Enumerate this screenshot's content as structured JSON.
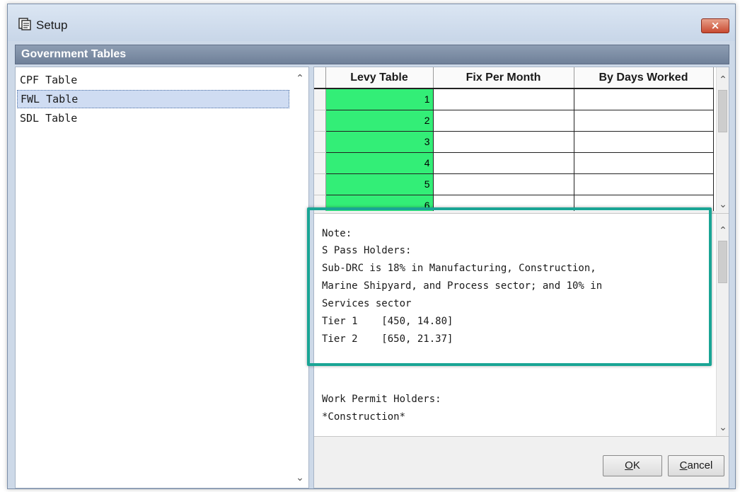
{
  "window": {
    "title": "Setup",
    "close_label": "×",
    "section_header": "Government Tables"
  },
  "left_list": {
    "items": [
      {
        "label": "CPF Table",
        "selected": false
      },
      {
        "label": "FWL Table",
        "selected": true
      },
      {
        "label": "SDL Table",
        "selected": false
      }
    ]
  },
  "grid": {
    "columns": [
      "Levy Table",
      "Fix Per Month",
      "By Days Worked"
    ],
    "rows": [
      {
        "levy": "1",
        "fix": "",
        "days": ""
      },
      {
        "levy": "2",
        "fix": "",
        "days": ""
      },
      {
        "levy": "3",
        "fix": "",
        "days": ""
      },
      {
        "levy": "4",
        "fix": "",
        "days": ""
      },
      {
        "levy": "5",
        "fix": "",
        "days": ""
      },
      {
        "levy": "6",
        "fix": "",
        "days": ""
      }
    ],
    "levy_cell_color": "#33ee77"
  },
  "note": {
    "lines": [
      "Note:",
      "S Pass Holders:",
      "Sub-DRC is 18% in Manufacturing, Construction,",
      "Marine Shipyard, and Process sector; and 10% in",
      "Services sector",
      "Tier 1    [450, 14.80]",
      "Tier 2    [650, 21.37]",
      "",
      "",
      "Work Permit Holders:",
      "*Construction*"
    ],
    "highlight_color": "#1aa595"
  },
  "buttons": {
    "ok_mnemonic": "O",
    "ok_rest": "K",
    "cancel_mnemonic": "C",
    "cancel_rest": "ancel"
  }
}
